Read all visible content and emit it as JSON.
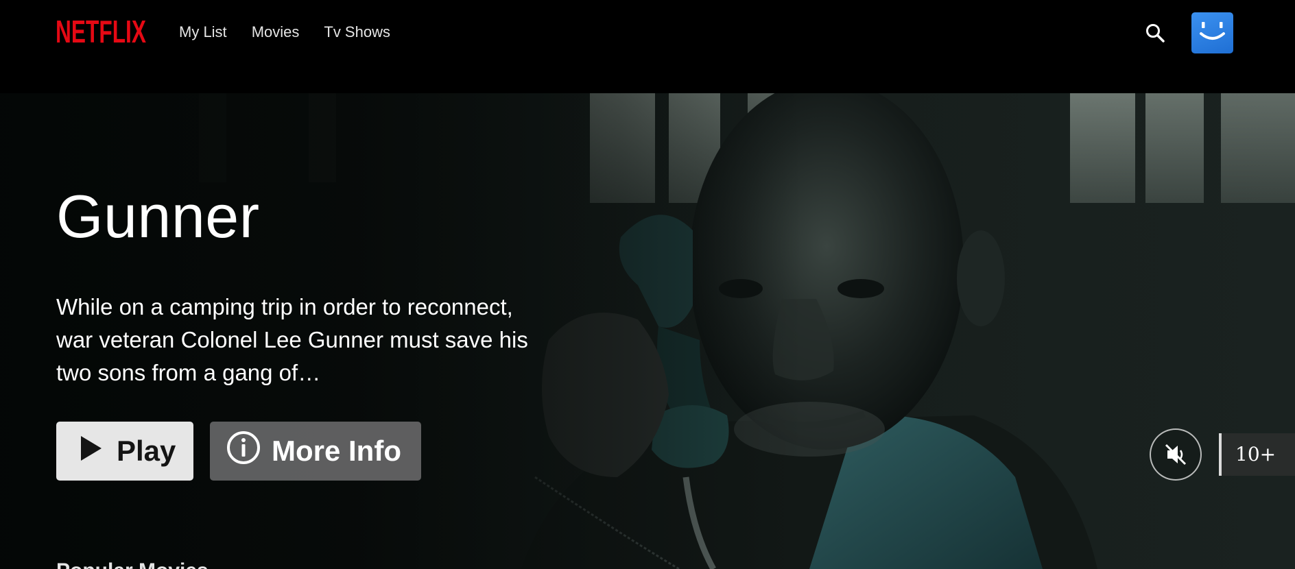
{
  "brand": {
    "logo_text": "NETFLIX",
    "color": "#e50914"
  },
  "nav": {
    "links": [
      "My List",
      "Movies",
      "Tv Shows"
    ],
    "search_icon": "search-icon",
    "avatar_icon": "smiley-avatar-icon"
  },
  "hero": {
    "title": "Gunner",
    "synopsis": "While on a camping trip in order to reconnect, war veteran Colonel Lee Gunner must save his two sons from a gang of…",
    "play_label": "Play",
    "more_info_label": "More Info",
    "mute_icon": "volume-muted-icon",
    "maturity_rating": "10+"
  },
  "rows": [
    {
      "heading": "Popular Movies"
    }
  ],
  "colors": {
    "play_bg": "#e6e6e6",
    "info_bg": "#6d6d6e",
    "avatar": "#2f80e0"
  }
}
